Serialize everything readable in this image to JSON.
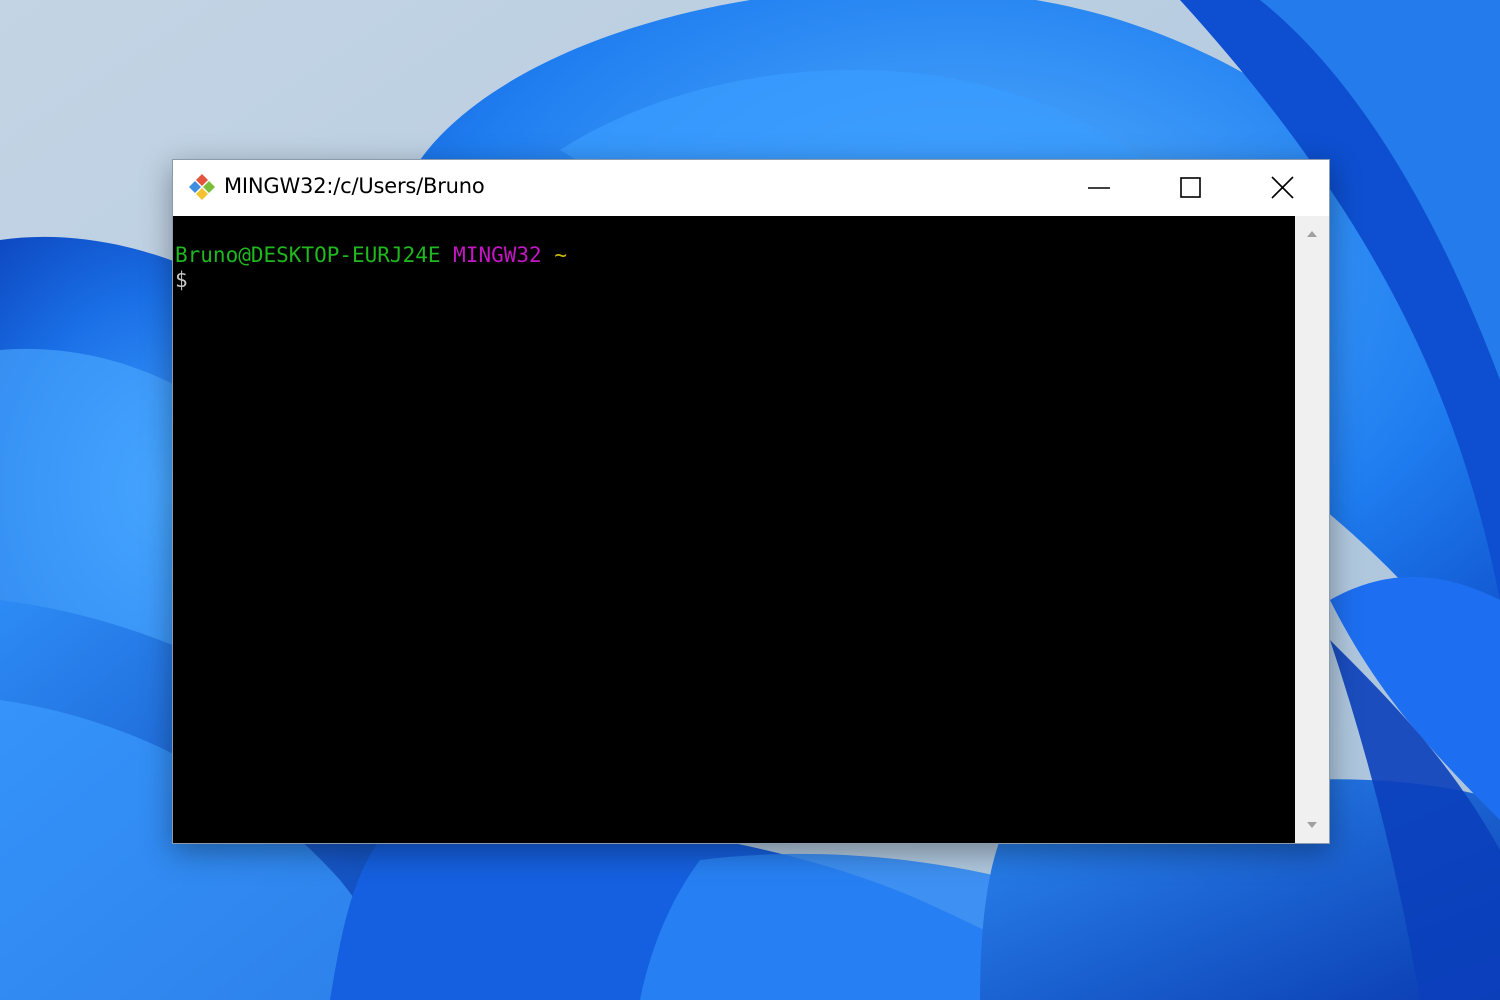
{
  "window": {
    "title": "MINGW32:/c/Users/Bruno",
    "app_icon": "git-bash-icon"
  },
  "controls": {
    "minimize_icon": "minimize-icon",
    "maximize_icon": "maximize-icon",
    "close_icon": "close-icon"
  },
  "terminal": {
    "prompt_user_host": "Bruno@DESKTOP-EURJ24E",
    "prompt_system": "MINGW32",
    "prompt_path": "~",
    "prompt_symbol": "$"
  },
  "colors": {
    "user_host": "#1fb81f",
    "system": "#c416c4",
    "path": "#c8b800",
    "terminal_bg": "#000000",
    "desktop_accent": "#1e6fe8"
  }
}
